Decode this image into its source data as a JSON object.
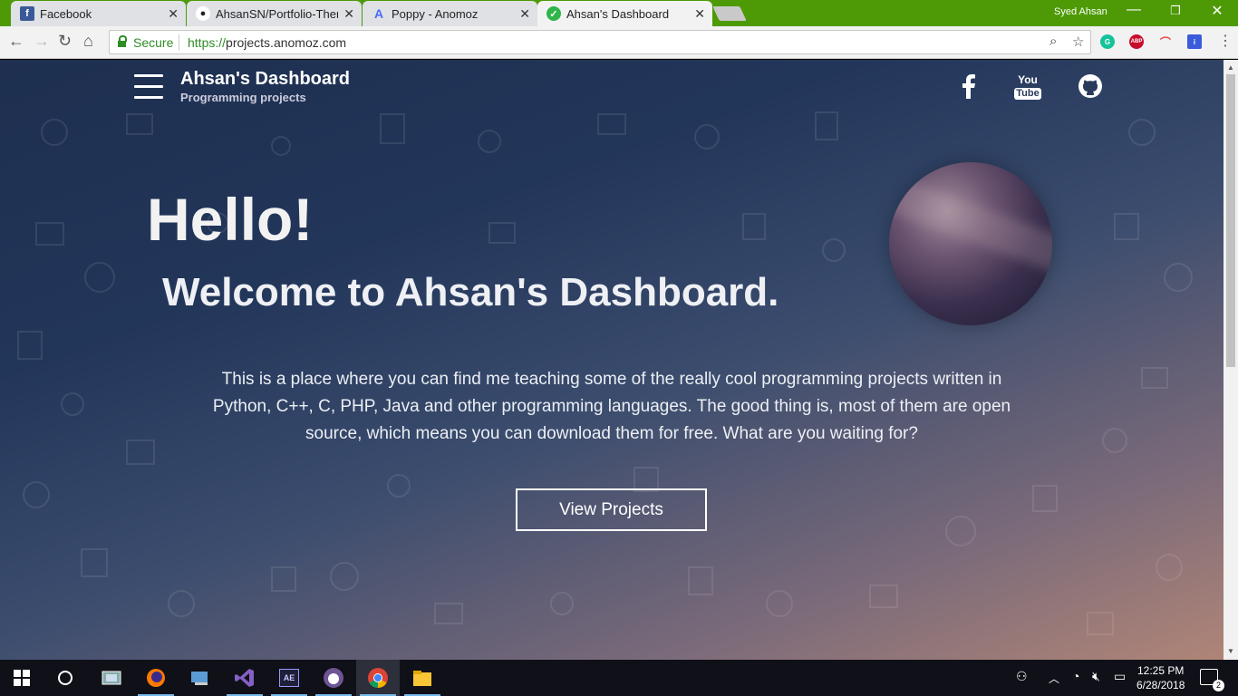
{
  "browser": {
    "tabs": [
      {
        "title": "Facebook",
        "favicon": "facebook-icon",
        "color": "#3b5998"
      },
      {
        "title": "AhsanSN/Portfolio-Them",
        "favicon": "github-icon",
        "color": "#222222"
      },
      {
        "title": "Poppy - Anomoz",
        "favicon": "anomoz-icon",
        "color": "#4a6cf7"
      },
      {
        "title": "Ahsan's Dashboard",
        "favicon": "dashboard-icon",
        "color": "#2fb54a",
        "active": true
      }
    ],
    "profile_name": "Syed Ahsan",
    "secure_label": "Secure",
    "url_proto": "https://",
    "url_host": "projects.anomoz.com",
    "accent": "#4e9a06"
  },
  "page": {
    "brand_title": "Ahsan's Dashboard",
    "brand_subtitle": "Programming projects",
    "social": [
      "facebook-icon",
      "youtube-icon",
      "github-icon"
    ],
    "youtube_top": "You",
    "youtube_bottom": "Tube",
    "hello": "Hello!",
    "welcome": "Welcome to Ahsan's Dashboard.",
    "intro": "This is a place where you can find me teaching some of the really cool programming projects written in Python, C++, C, PHP, Java and other programming languages. The good thing is, most of them are open source, which means you can download them for free. What are you waiting for?",
    "cta_label": "View Projects"
  },
  "taskbar": {
    "time": "12:25 PM",
    "date": "6/28/2018",
    "notifications": "2",
    "apps": [
      "windows-start-icon",
      "cortana-icon",
      "task-view-icon",
      "firefox-icon",
      "file-transfer-icon",
      "visual-studio-icon",
      "after-effects-icon",
      "github-desktop-icon",
      "chrome-icon",
      "file-explorer-icon"
    ],
    "ae_label": "AE"
  }
}
